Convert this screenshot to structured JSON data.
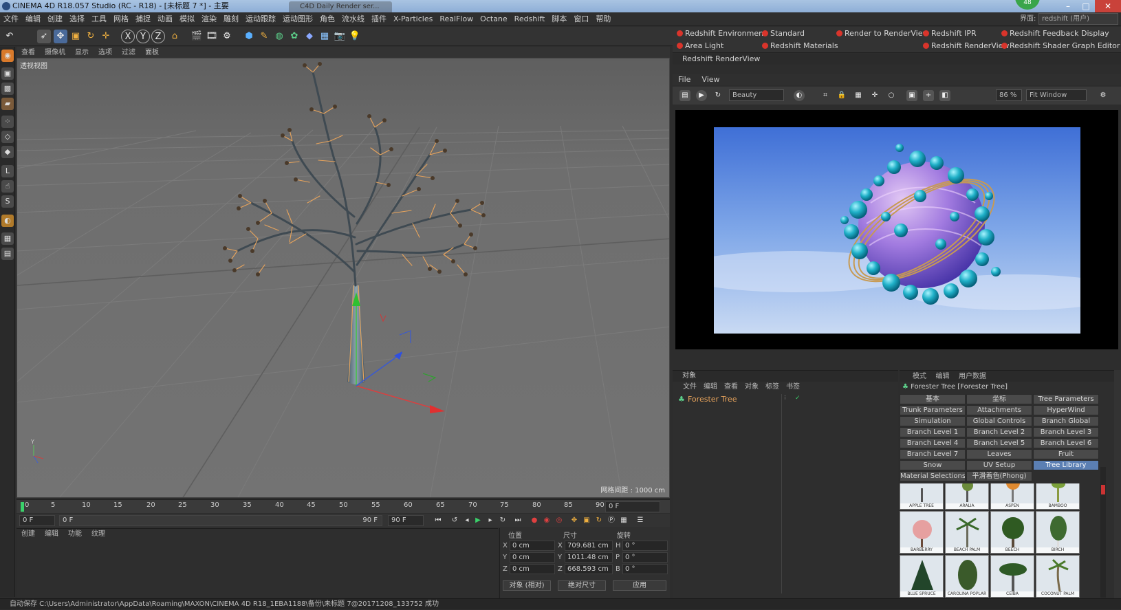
{
  "window": {
    "title": "CINEMA 4D R18.057 Studio (RC - R18) - [未标题 7 *] - 主要",
    "second_tab": "C4D Daily Render ser...",
    "badge": "48",
    "minimize": "–",
    "maximize": "□",
    "close": "✕"
  },
  "menu": {
    "items": [
      "文件",
      "编辑",
      "创建",
      "选择",
      "工具",
      "网格",
      "捕捉",
      "动画",
      "模拟",
      "渲染",
      "雕刻",
      "运动跟踪",
      "运动图形",
      "角色",
      "流水线",
      "插件",
      "X-Particles",
      "RealFlow",
      "Octane",
      "Redshift",
      "脚本",
      "窗口",
      "帮助"
    ],
    "interface_label": "界面:",
    "interface_value": "redshift (用户)"
  },
  "viewport": {
    "menu": [
      "查看",
      "摄像机",
      "显示",
      "选项",
      "过滤",
      "面板"
    ],
    "label": "透视视图",
    "grid_distance": "网格间距 : 1000 cm"
  },
  "timeline": {
    "ticks": [
      "0",
      "5",
      "10",
      "15",
      "20",
      "25",
      "30",
      "35",
      "40",
      "45",
      "50",
      "55",
      "60",
      "65",
      "70",
      "75",
      "80",
      "85",
      "90"
    ],
    "frame_field": "0 F"
  },
  "playback": {
    "start": "0 F",
    "range_start": "0 F",
    "range_end": "90 F",
    "end": "90 F"
  },
  "material_manager": {
    "menu": [
      "创建",
      "编辑",
      "功能",
      "纹理"
    ]
  },
  "coords": {
    "headers": [
      "位置",
      "尺寸",
      "旋转"
    ],
    "rows": [
      {
        "axis": "X",
        "pos": "0 cm",
        "size_axis": "X",
        "size": "709.681 cm",
        "rot_axis": "H",
        "rot": "0 °"
      },
      {
        "axis": "Y",
        "pos": "0 cm",
        "size_axis": "Y",
        "size": "1011.48 cm",
        "rot_axis": "P",
        "rot": "0 °"
      },
      {
        "axis": "Z",
        "pos": "0 cm",
        "size_axis": "Z",
        "size": "668.593 cm",
        "rot_axis": "B",
        "rot": "0 °"
      }
    ],
    "mode1": "对象 (相对)",
    "mode2": "绝对尺寸",
    "apply": "应用"
  },
  "redshift_toolbar": {
    "buttons": [
      "Redshift Environment",
      "Standard",
      "Render to RenderView",
      "Redshift IPR",
      "Redshift Feedback Display",
      "Area Light",
      "Redshift Materials",
      "Redshift RenderView",
      "Redshift Shader Graph Editor"
    ]
  },
  "renderview": {
    "title": "Redshift RenderView",
    "menu": [
      "File",
      "View"
    ],
    "aov": "Beauty",
    "zoom": "86 %",
    "fit": "Fit Window"
  },
  "object_manager": {
    "title": "对象",
    "menu": [
      "文件",
      "编辑",
      "查看",
      "对象",
      "标签",
      "书签"
    ],
    "objects": [
      "Forester Tree"
    ]
  },
  "attribute_manager": {
    "menu": [
      "模式",
      "编辑",
      "用户数据"
    ],
    "object_title": "Forester Tree [Forester Tree]",
    "tabs": [
      "基本",
      "坐标",
      "Tree Parameters",
      "Trunk Parameters",
      "Attachments",
      "HyperWind",
      "Simulation",
      "Global Controls",
      "Branch Global",
      "Branch Level 1",
      "Branch Level 2",
      "Branch Level 3",
      "Branch Level 4",
      "Branch Level 5",
      "Branch Level 6",
      "Branch Level 7",
      "Leaves",
      "Fruit",
      "Snow",
      "UV Setup",
      "Tree Library",
      "Material Selections",
      "平滑着色(Phong)"
    ],
    "active_tab": "Tree Library",
    "library": [
      "APPLE TREE",
      "ARALIA",
      "ASPEN",
      "BAMBOO",
      "BARBERRY",
      "BEACH PALM",
      "BEECH",
      "BIRCH",
      "BLUE SPRUCE",
      "CAROLINA POPLAR",
      "CEIBA",
      "COCONUT PALM"
    ]
  },
  "status": {
    "text": "自动保存 C:\\Users\\Administrator\\AppData\\Roaming\\MAXON\\CINEMA 4D R18_1EBA1188\\备份\\未标题 7@20171208_133752 成功"
  },
  "colors": {
    "accent": "#5b7fb3",
    "selection_orange": "#e8a45c",
    "redshift_red": "#d9342b"
  }
}
